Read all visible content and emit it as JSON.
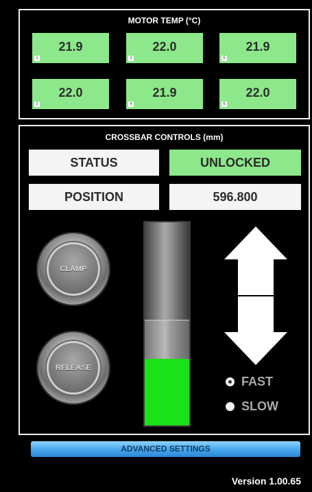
{
  "motor_temp": {
    "title": "MOTOR TEMP (°C)",
    "cells": [
      {
        "index": "1",
        "value": "21.9"
      },
      {
        "index": "3",
        "value": "22.0"
      },
      {
        "index": "5",
        "value": "21.9"
      },
      {
        "index": "2",
        "value": "22.0"
      },
      {
        "index": "4",
        "value": "21.9"
      },
      {
        "index": "6",
        "value": "22.0"
      }
    ]
  },
  "crossbar": {
    "title": "CROSSBAR CONTROLS (mm)",
    "status_label": "STATUS",
    "status_value": "UNLOCKED",
    "position_label": "POSITION",
    "position_value": "596.800",
    "clamp_label": "CLAMP",
    "release_label": "RELEASE",
    "slider_level": 0.33,
    "speed": {
      "fast_label": "FAST",
      "slow_label": "SLOW",
      "selected": "fast"
    }
  },
  "advanced_settings_label": "ADVANCED SETTINGS",
  "version": "Version 1.00.65"
}
